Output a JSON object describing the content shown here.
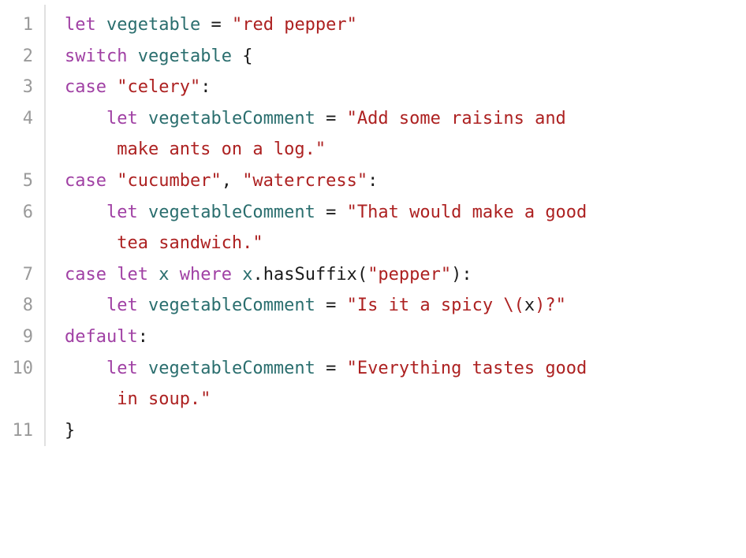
{
  "colors": {
    "keyword": "#a040a4",
    "identifier": "#2a6e6e",
    "string": "#ad2121",
    "plain": "#1b1b1b",
    "gutter": "#9a9a9a",
    "gutter_rule": "#e0e0e0",
    "background": "#ffffff"
  },
  "lines": [
    {
      "num": "1",
      "wraps": false,
      "tokens": [
        {
          "cls": "kw",
          "t": "let"
        },
        {
          "cls": "pln",
          "t": " "
        },
        {
          "cls": "id",
          "t": "vegetable"
        },
        {
          "cls": "pln",
          "t": " = "
        },
        {
          "cls": "str",
          "t": "\"red pepper\""
        }
      ]
    },
    {
      "num": "2",
      "wraps": false,
      "tokens": [
        {
          "cls": "kw",
          "t": "switch"
        },
        {
          "cls": "pln",
          "t": " "
        },
        {
          "cls": "id",
          "t": "vegetable"
        },
        {
          "cls": "pln",
          "t": " {"
        }
      ]
    },
    {
      "num": "3",
      "wraps": false,
      "tokens": [
        {
          "cls": "kw",
          "t": "case"
        },
        {
          "cls": "pln",
          "t": " "
        },
        {
          "cls": "str",
          "t": "\"celery\""
        },
        {
          "cls": "pln",
          "t": ":"
        }
      ]
    },
    {
      "num": "4",
      "wraps": true,
      "tokens": [
        {
          "cls": "pln",
          "t": "    "
        },
        {
          "cls": "kw",
          "t": "let"
        },
        {
          "cls": "pln",
          "t": " "
        },
        {
          "cls": "id",
          "t": "vegetableComment"
        },
        {
          "cls": "pln",
          "t": " = "
        },
        {
          "cls": "str",
          "t": "\"Add some raisins and "
        }
      ],
      "wrap_tokens": [
        {
          "cls": "str",
          "t": "make ants on a log.\""
        }
      ]
    },
    {
      "num": "5",
      "wraps": false,
      "tokens": [
        {
          "cls": "kw",
          "t": "case"
        },
        {
          "cls": "pln",
          "t": " "
        },
        {
          "cls": "str",
          "t": "\"cucumber\""
        },
        {
          "cls": "pln",
          "t": ", "
        },
        {
          "cls": "str",
          "t": "\"watercress\""
        },
        {
          "cls": "pln",
          "t": ":"
        }
      ]
    },
    {
      "num": "6",
      "wraps": true,
      "tokens": [
        {
          "cls": "pln",
          "t": "    "
        },
        {
          "cls": "kw",
          "t": "let"
        },
        {
          "cls": "pln",
          "t": " "
        },
        {
          "cls": "id",
          "t": "vegetableComment"
        },
        {
          "cls": "pln",
          "t": " = "
        },
        {
          "cls": "str",
          "t": "\"That would make a good "
        }
      ],
      "wrap_tokens": [
        {
          "cls": "str",
          "t": "tea sandwich.\""
        }
      ]
    },
    {
      "num": "7",
      "wraps": false,
      "tokens": [
        {
          "cls": "kw",
          "t": "case"
        },
        {
          "cls": "pln",
          "t": " "
        },
        {
          "cls": "kw",
          "t": "let"
        },
        {
          "cls": "pln",
          "t": " "
        },
        {
          "cls": "id",
          "t": "x"
        },
        {
          "cls": "pln",
          "t": " "
        },
        {
          "cls": "kw",
          "t": "where"
        },
        {
          "cls": "pln",
          "t": " "
        },
        {
          "cls": "id",
          "t": "x"
        },
        {
          "cls": "pln",
          "t": "."
        },
        {
          "cls": "call",
          "t": "hasSuffix"
        },
        {
          "cls": "pln",
          "t": "("
        },
        {
          "cls": "str",
          "t": "\"pepper\""
        },
        {
          "cls": "pln",
          "t": "):"
        }
      ]
    },
    {
      "num": "8",
      "wraps": false,
      "tokens": [
        {
          "cls": "pln",
          "t": "    "
        },
        {
          "cls": "kw",
          "t": "let"
        },
        {
          "cls": "pln",
          "t": " "
        },
        {
          "cls": "id",
          "t": "vegetableComment"
        },
        {
          "cls": "pln",
          "t": " = "
        },
        {
          "cls": "str",
          "t": "\"Is it a spicy "
        },
        {
          "cls": "interp-delim",
          "t": "\\("
        },
        {
          "cls": "interp-inner",
          "t": "x"
        },
        {
          "cls": "interp-delim",
          "t": ")"
        },
        {
          "cls": "str",
          "t": "?\""
        }
      ]
    },
    {
      "num": "9",
      "wraps": false,
      "tokens": [
        {
          "cls": "kw",
          "t": "default"
        },
        {
          "cls": "pln",
          "t": ":"
        }
      ]
    },
    {
      "num": "10",
      "wraps": true,
      "tokens": [
        {
          "cls": "pln",
          "t": "    "
        },
        {
          "cls": "kw",
          "t": "let"
        },
        {
          "cls": "pln",
          "t": " "
        },
        {
          "cls": "id",
          "t": "vegetableComment"
        },
        {
          "cls": "pln",
          "t": " = "
        },
        {
          "cls": "str",
          "t": "\"Everything tastes good "
        }
      ],
      "wrap_tokens": [
        {
          "cls": "str",
          "t": "in soup.\""
        }
      ]
    },
    {
      "num": "11",
      "wraps": false,
      "tokens": [
        {
          "cls": "pln",
          "t": "}"
        }
      ]
    }
  ]
}
